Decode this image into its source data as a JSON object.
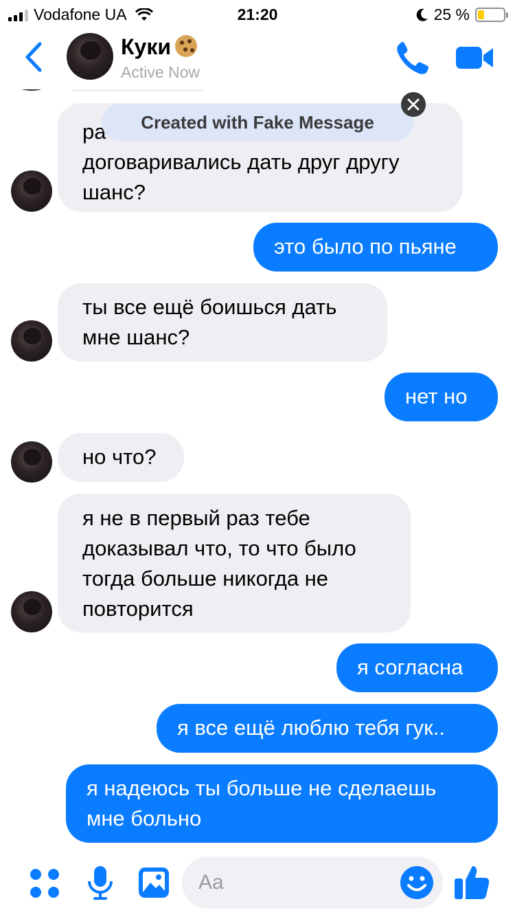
{
  "status_bar": {
    "carrier": "Vodafone UA",
    "time": "21:20",
    "battery_percent": "25 %",
    "battery_level": 0.25
  },
  "header": {
    "contact_name": "Куки",
    "contact_emoji": "cookie",
    "contact_status": "Active Now",
    "icons": [
      "back-chevron-icon",
      "phone-icon",
      "video-camera-icon"
    ]
  },
  "watermark": {
    "text": "Created with Fake Message"
  },
  "messages": [
    {
      "side": "in",
      "partial_text": "ра",
      "text": "договаривались дать друг другу шанс?",
      "line1": "договаривались дать друг другу",
      "line2": "шанс?"
    },
    {
      "side": "out",
      "text": "это было по пьяне"
    },
    {
      "side": "in",
      "line1": "ты все ещё боишься дать",
      "line2": "мне шанс?"
    },
    {
      "side": "out",
      "text": "нет но"
    },
    {
      "side": "in",
      "text": "но что?"
    },
    {
      "side": "in",
      "line1": "я не в первый раз тебе",
      "line2": "доказывал что, то что было",
      "line3": "тогда больше никогда не",
      "line4": "повторится"
    },
    {
      "side": "out",
      "text": "я согласна"
    },
    {
      "side": "out",
      "text": "я все ещё люблю тебя гук.."
    },
    {
      "side": "out",
      "line1": "я надеюсь ты больше не сделаешь",
      "line2": "мне больно"
    }
  ],
  "composer": {
    "placeholder": "Aa",
    "icons": [
      "apps-grid-icon",
      "microphone-icon",
      "photo-icon",
      "emoji-icon",
      "thumbs-up-icon"
    ]
  },
  "colors": {
    "accent": "#0a7cff",
    "incoming_bubble": "#efeef2",
    "battery": "#ffcc00"
  }
}
